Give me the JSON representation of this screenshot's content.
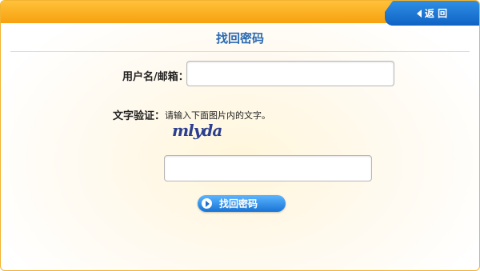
{
  "header": {
    "back_label": "返 回"
  },
  "page": {
    "title": "找回密码"
  },
  "form": {
    "username_label": "用户名/邮箱：",
    "username_value": "",
    "captcha_label": "文字验证：",
    "captcha_hint": "请输入下面图片内的文字。",
    "captcha_text": "mlyda",
    "captcha_value": "",
    "submit_label": "找回密码"
  },
  "colors": {
    "top_bar": "#f7a10f",
    "back_tab": "#0f63c3",
    "title_blue": "#2b6ab3",
    "button_blue": "#1873d6"
  }
}
